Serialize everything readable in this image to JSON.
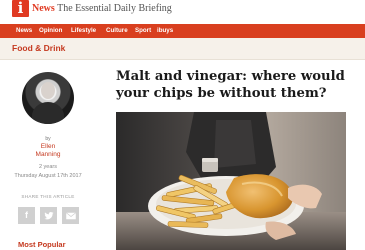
{
  "brand": {
    "logo_letter": "i",
    "name": "News",
    "tagline": "The Essential Daily Briefing",
    "accent_color": "#e03a22"
  },
  "nav": {
    "items": [
      "News",
      "Opinion",
      "Lifestyle",
      "Culture",
      "Sport",
      "ibuys"
    ],
    "bar_color": "#d93f1f"
  },
  "section": {
    "title": "Food & Drink"
  },
  "author": {
    "by_label": "by",
    "name": "Ellen Manning",
    "time_ago": "2 years",
    "date": "Thursday August 17th 2017"
  },
  "share": {
    "label": "SHARE THIS ARTICLE",
    "buttons": [
      {
        "icon": "facebook-icon",
        "glyph": "f"
      },
      {
        "icon": "twitter-icon",
        "glyph": "t"
      },
      {
        "icon": "email-icon",
        "glyph": "✉"
      }
    ]
  },
  "sidebar": {
    "most_popular_label": "Most Popular"
  },
  "article": {
    "headline": "Malt and vinegar: where would your chips be without them?"
  }
}
